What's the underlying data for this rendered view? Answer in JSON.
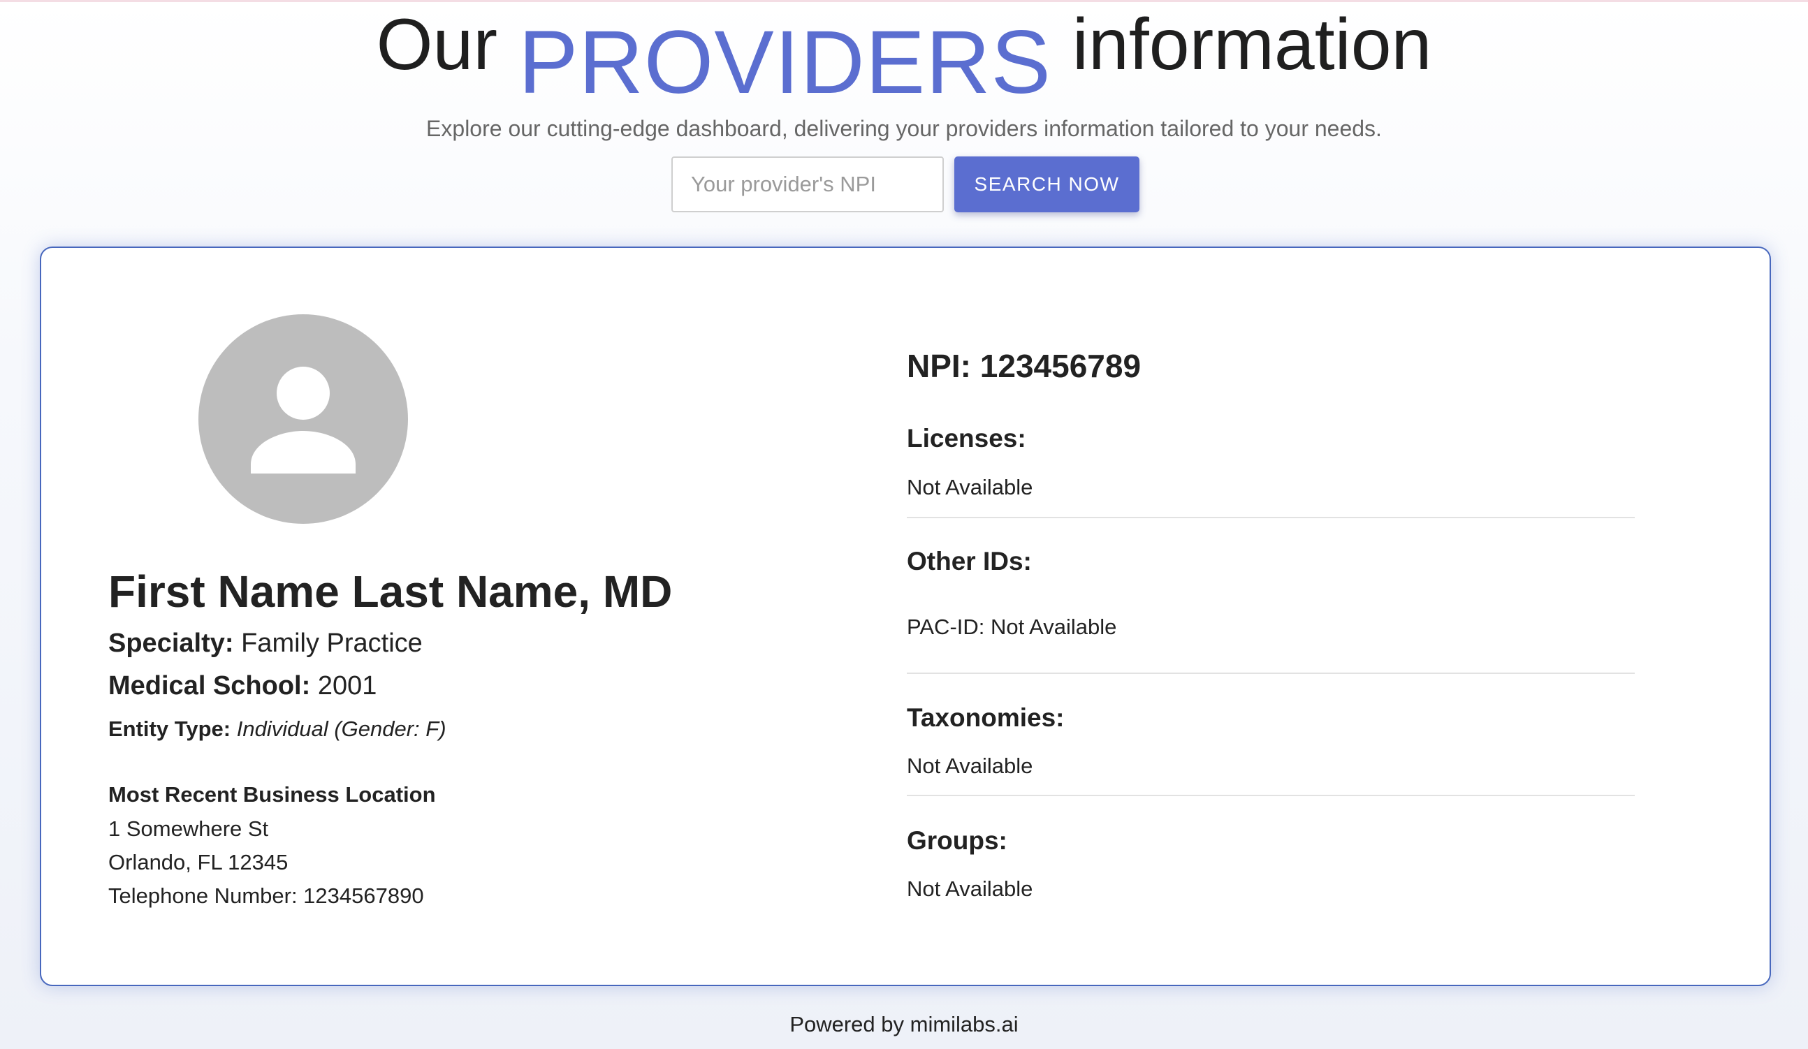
{
  "hero": {
    "title_part1": "Our",
    "title_accent": "PROVIDERS",
    "title_part2": "information",
    "subtitle": "Explore our cutting-edge dashboard, delivering your providers information tailored to your needs."
  },
  "search": {
    "placeholder": "Your provider's NPI",
    "value": "",
    "button_label": "SEARCH NOW"
  },
  "provider": {
    "avatar_icon": "person-icon",
    "name": "First Name Last Name, MD",
    "specialty_label": "Specialty:",
    "specialty": "Family Practice",
    "medical_school_label": "Medical School:",
    "medical_school": "2001",
    "entity_type_label": "Entity Type:",
    "entity_type": "Individual (Gender: F)",
    "location_heading": "Most Recent Business Location",
    "address_line1": "1 Somewhere St",
    "address_line2": "Orlando, FL 12345",
    "telephone": "Telephone Number: 1234567890"
  },
  "details": {
    "npi": "NPI: 123456789",
    "licenses_label": "Licenses:",
    "licenses_value": "Not Available",
    "other_ids_label": "Other IDs:",
    "other_ids_value": "PAC-ID: Not Available",
    "taxonomies_label": "Taxonomies:",
    "taxonomies_value": "Not Available",
    "groups_label": "Groups:",
    "groups_value": "Not Available"
  },
  "footer": {
    "text": "Powered by mimilabs.ai"
  },
  "colors": {
    "accent": "#5b6ed0",
    "card_border": "#4767bd",
    "avatar_bg": "#bdbdbd"
  }
}
